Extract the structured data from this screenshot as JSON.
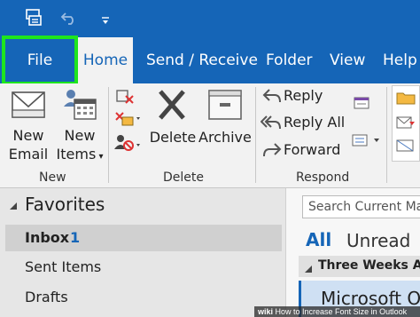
{
  "quick_access": {
    "icons": [
      "send-receive-icon",
      "undo-icon",
      "customize-dropdown-icon"
    ]
  },
  "tabs": {
    "file": "File",
    "home": "Home",
    "send_receive": "Send / Receive",
    "folder": "Folder",
    "view": "View",
    "help": "Help"
  },
  "ribbon": {
    "new_group": {
      "label": "New",
      "new_email": "New Email",
      "new_email_l1": "New",
      "new_email_l2": "Email",
      "new_items_l1": "New",
      "new_items_l2": "Items"
    },
    "delete_group": {
      "label": "Delete",
      "delete": "Delete",
      "archive": "Archive"
    },
    "respond_group": {
      "label": "Respond",
      "reply": "Reply",
      "reply_all": "Reply All",
      "forward": "Forward"
    }
  },
  "folder_pane": {
    "favorites": "Favorites",
    "items": [
      {
        "label": "Inbox",
        "count": "1"
      },
      {
        "label": "Sent Items"
      },
      {
        "label": "Drafts"
      }
    ]
  },
  "list_pane": {
    "search_placeholder": "Search Current Mail",
    "filter_all": "All",
    "filter_unread": "Unread",
    "group_header": "Three Weeks A",
    "message_sender": "Microsoft O"
  },
  "watermark": {
    "brand": "wiki",
    "text": "How to Increase Font Size in Outlook"
  },
  "colors": {
    "ribbon_blue": "#1565b7",
    "highlight_green": "#1ee51e",
    "ribbon_bg": "#f2f2f2"
  }
}
